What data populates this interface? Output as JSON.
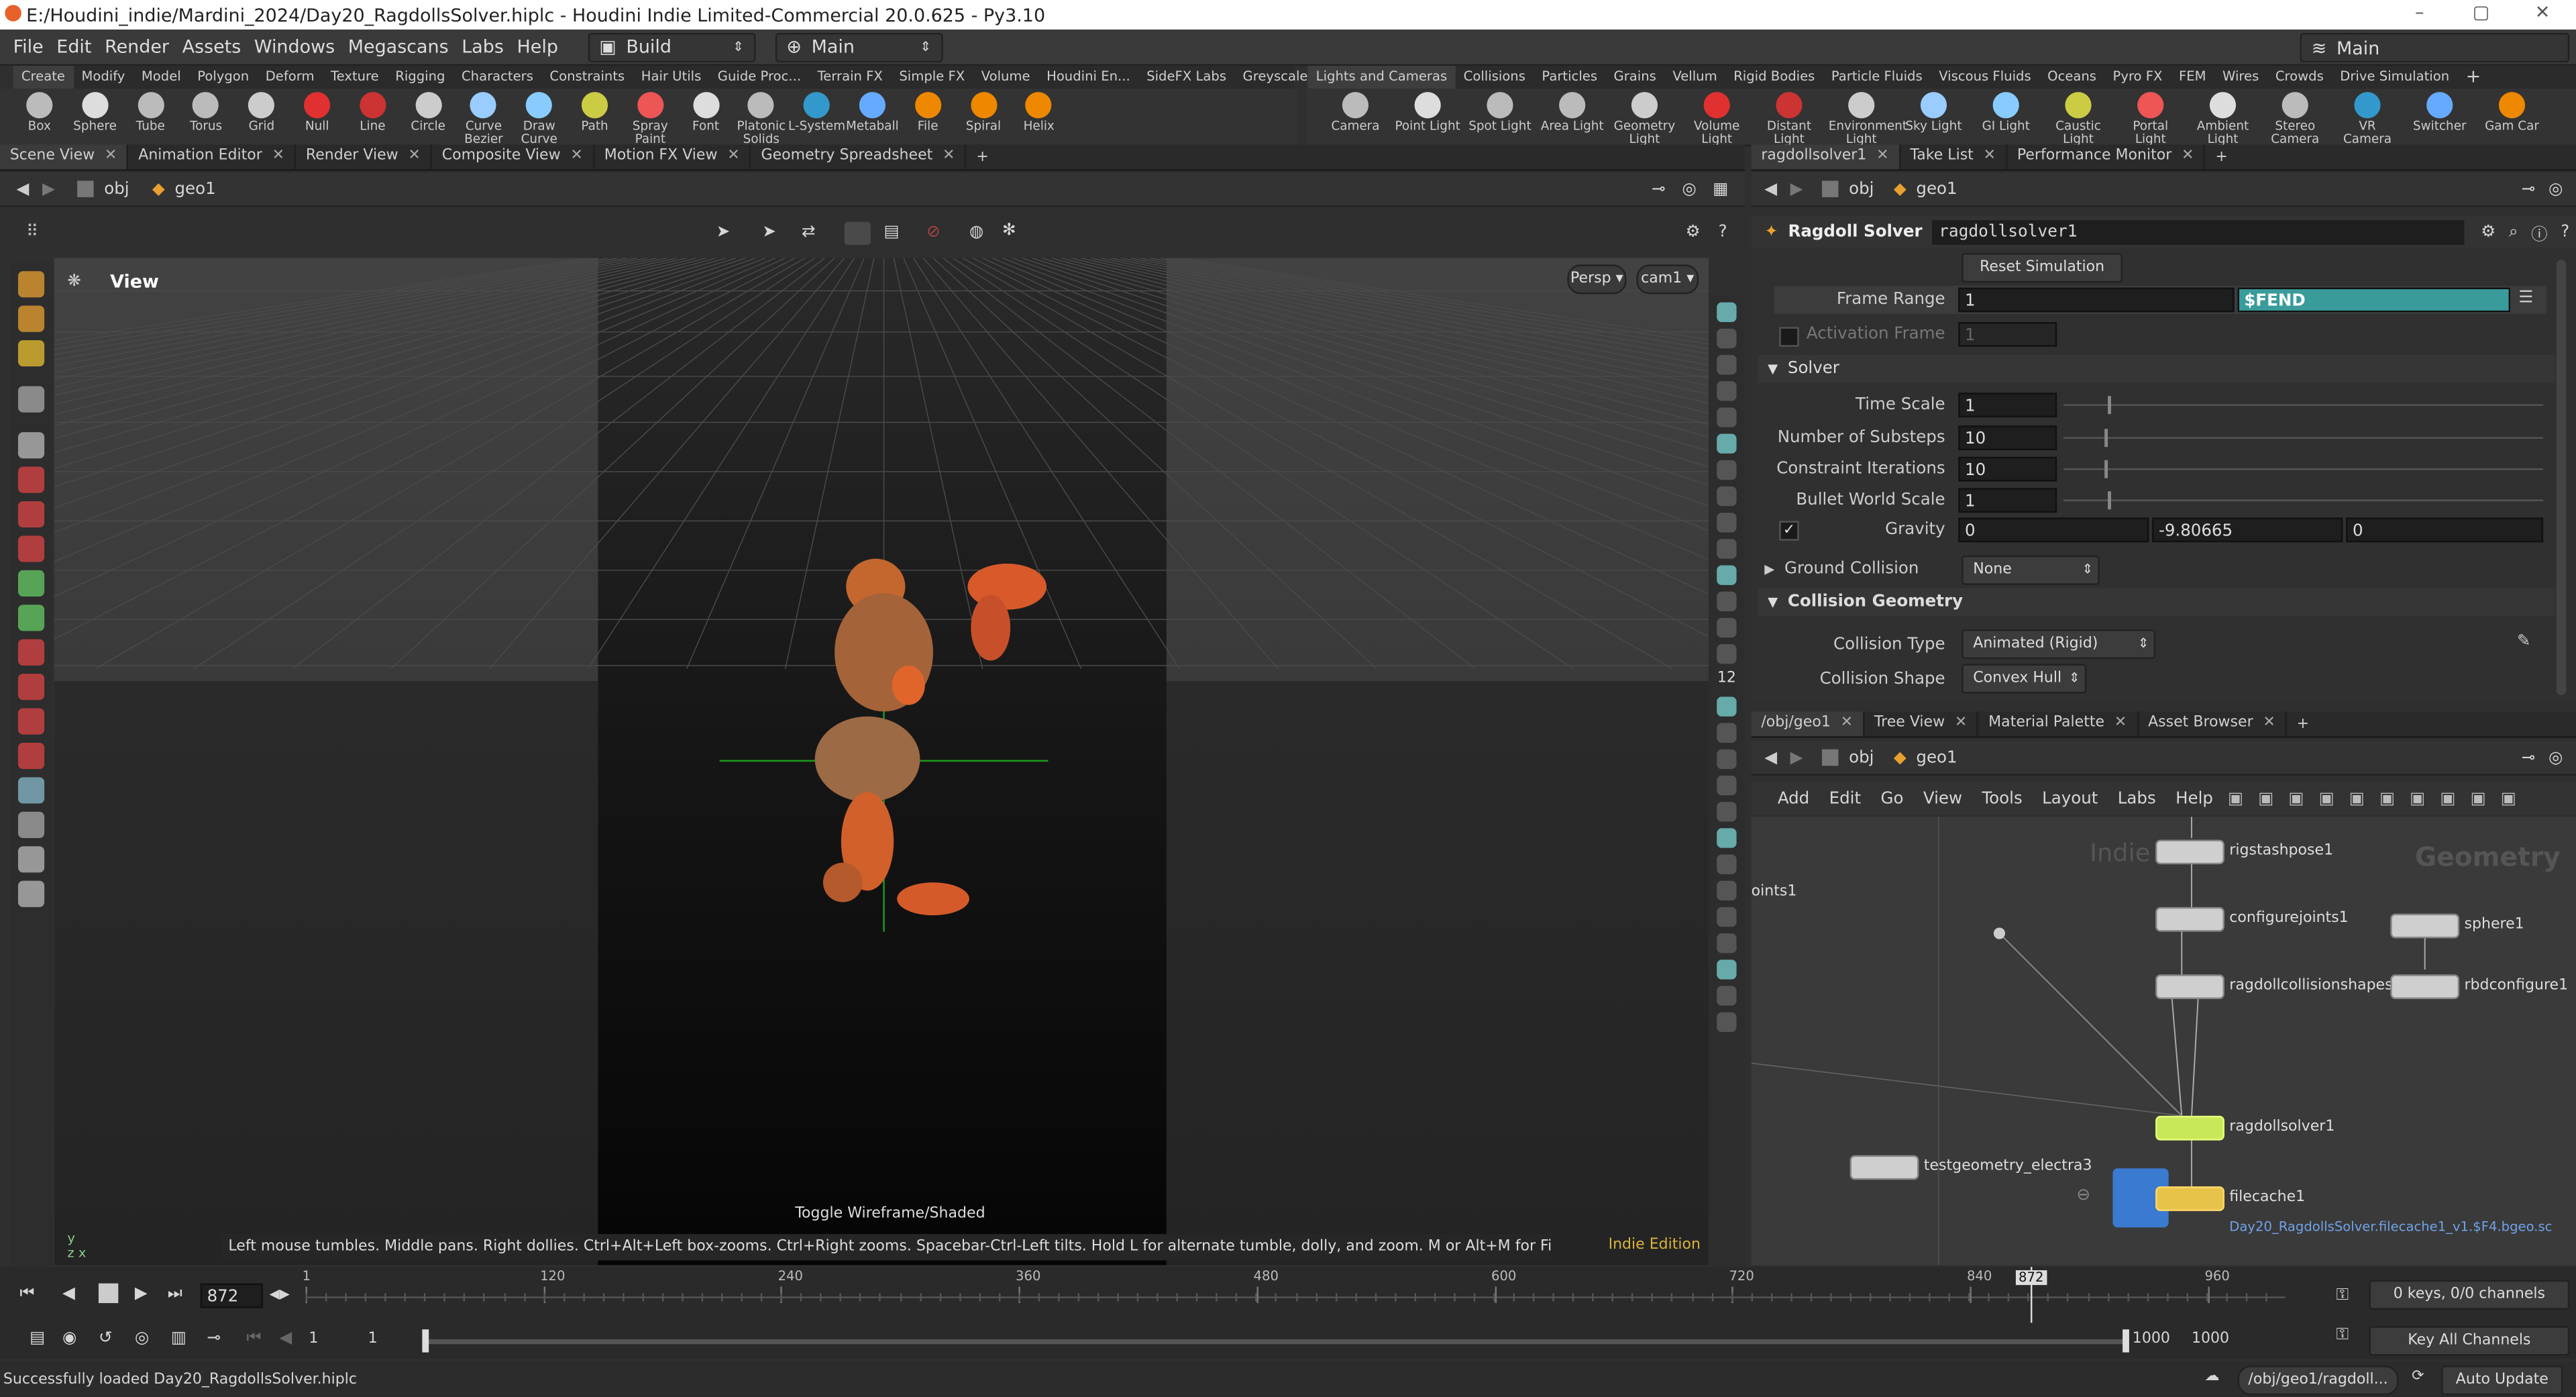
{
  "title_bar": {
    "text": "E:/Houdini_indie/Mardini_2024/Day20_RagdollsSolver.hiplc - Houdini Indie Limited-Commercial 20.0.625 - Py3.10"
  },
  "menu": {
    "items": [
      "File",
      "Edit",
      "Render",
      "Assets",
      "Windows",
      "Megascans",
      "Labs",
      "Help"
    ],
    "desktop": "Build",
    "context": "Main",
    "right_context": "Main"
  },
  "shelf": {
    "left_tabs": [
      "Create",
      "Modify",
      "Model",
      "Polygon",
      "Deform",
      "Texture",
      "Rigging",
      "Characters",
      "Constraints",
      "Hair Utils",
      "Guide Proc...",
      "Terrain FX",
      "Simple FX",
      "Volume",
      "Houdini En...",
      "SideFX Labs",
      "Greyscaleg..."
    ],
    "right_tabs": [
      "Lights and Cameras",
      "Collisions",
      "Particles",
      "Grains",
      "Vellum",
      "Rigid Bodies",
      "Particle Fluids",
      "Viscous Fluids",
      "Oceans",
      "Pyro FX",
      "FEM",
      "Wires",
      "Crowds",
      "Drive Simulation"
    ],
    "left_tools": [
      "Box",
      "Sphere",
      "Tube",
      "Torus",
      "Grid",
      "Null",
      "Line",
      "Circle",
      "Curve Bezier",
      "Draw Curve",
      "Path",
      "Spray Paint",
      "Font",
      "Platonic Solids",
      "L-System",
      "Metaball",
      "File",
      "Spiral",
      "Helix"
    ],
    "right_tools": [
      "Camera",
      "Point Light",
      "Spot Light",
      "Area Light",
      "Geometry Light",
      "Volume Light",
      "Distant Light",
      "Environment Light",
      "Sky Light",
      "GI Light",
      "Caustic Light",
      "Portal Light",
      "Ambient Light",
      "Stereo Camera",
      "VR Camera",
      "Switcher",
      "Gam Car"
    ]
  },
  "viewer": {
    "tabs": [
      "Scene View",
      "Animation Editor",
      "Render View",
      "Composite View",
      "Motion FX View",
      "Geometry Spreadsheet"
    ],
    "path": [
      "obj",
      "geo1"
    ],
    "view_label": "View",
    "persp": "Persp",
    "camera": "cam1",
    "tooltip": "Toggle Wireframe/Shaded",
    "status_hint": "Left mouse tumbles. Middle pans. Right dollies. Ctrl+Alt+Left box-zooms. Ctrl+Right zooms. Spacebar-Ctrl-Left tilts. Hold L for alternate tumble, dolly, and zoom. M or Alt+M for First Person Navigation.",
    "edition": "Indie Edition",
    "right_icon_label": "12"
  },
  "parms": {
    "tabs": [
      "ragdollsolver1",
      "Take List",
      "Performance Monitor"
    ],
    "path": [
      "obj",
      "geo1"
    ],
    "node_type": "Ragdoll Solver",
    "node_name": "ragdollsolver1",
    "reset_button": "Reset Simulation",
    "frame_range_label": "Frame Range",
    "frame_range_start": "1",
    "frame_range_end": "$FEND",
    "activation_frame_label": "Activation Frame",
    "activation_frame_value": "1",
    "solver_section": "Solver",
    "time_scale_label": "Time Scale",
    "time_scale": "1",
    "substeps_label": "Number of Substeps",
    "substeps": "10",
    "constraint_iter_label": "Constraint Iterations",
    "constraint_iter": "10",
    "bullet_scale_label": "Bullet World Scale",
    "bullet_scale": "1",
    "gravity_label": "Gravity",
    "gravity": [
      "0",
      "-9.80665",
      "0"
    ],
    "ground_collision_label": "Ground Collision",
    "ground_collision": "None",
    "collision_geo_section": "Collision Geometry",
    "collision_type_label": "Collision Type",
    "collision_type": "Animated (Rigid)",
    "collision_shape_label": "Collision Shape",
    "collision_shape": "Convex Hull"
  },
  "network": {
    "tabs": [
      "/obj/geo1",
      "Tree View",
      "Material Palette",
      "Asset Browser"
    ],
    "path": [
      "obj",
      "geo1"
    ],
    "menu": [
      "Add",
      "Edit",
      "Go",
      "View",
      "Tools",
      "Layout",
      "Labs",
      "Help"
    ],
    "watermark_left": "Indie",
    "watermark_right": "Geometry",
    "nodes": {
      "rigstashpose": "rigstashpose1",
      "configurejoints": "configurejoints1",
      "collisionshapes": "ragdollcollisionshapes1",
      "sphere": "sphere1",
      "rbdconfigure": "rbdconfigure1",
      "solver": "ragdollsolver1",
      "testgeo": "testgeometry_electra3",
      "filecache": "filecache1",
      "filecache_path": "Day20_RagdollsSolver.filecache1_v1.$F4.bgeo.sc",
      "partial_left": "oints1"
    }
  },
  "timeline": {
    "current_frame": "872",
    "ticks": [
      "1",
      "120",
      "240",
      "360",
      "480",
      "600",
      "720",
      "840",
      "960"
    ],
    "range_start": "1",
    "range_start2": "1",
    "range_end": "1000",
    "range_end2": "1000",
    "keys_info": "0 keys, 0/0 channels",
    "key_all": "Key All Channels",
    "playhead_fraction": 0.8711
  },
  "status_bar": {
    "message": "Successfully loaded Day20_RagdollsSolver.hiplc",
    "path": "/obj/geo1/ragdoll...",
    "update_mode": "Auto Update"
  },
  "colors": {
    "accent_teal": "#3a9b9b",
    "node_selected": "#c8e85a",
    "filecache_node": "#e8c34a",
    "character": "#d85a2a"
  }
}
